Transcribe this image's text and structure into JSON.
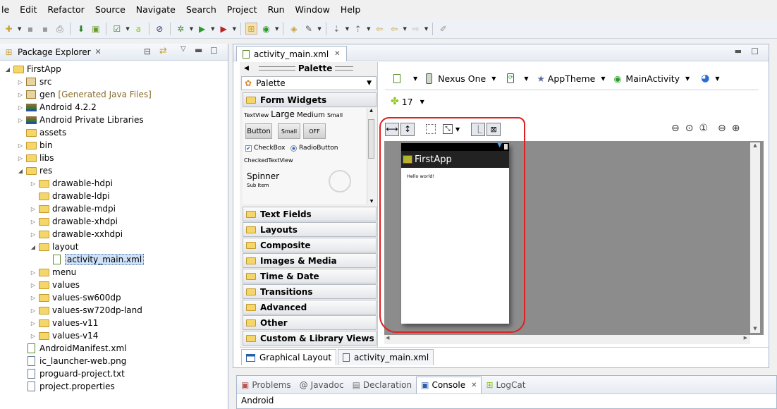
{
  "menu": [
    "le",
    "Edit",
    "Refactor",
    "Source",
    "Navigate",
    "Search",
    "Project",
    "Run",
    "Window",
    "Help"
  ],
  "package_explorer": {
    "title": "Package Explorer",
    "items": [
      {
        "label": "FirstApp",
        "suffix": "",
        "icon": "project-icon"
      },
      {
        "label": "src",
        "suffix": "",
        "icon": "package-folder-icon"
      },
      {
        "label": "gen",
        "suffix": " [Generated Java Files]",
        "icon": "package-folder-icon"
      },
      {
        "label": "Android 4.2.2",
        "suffix": "",
        "icon": "library-icon"
      },
      {
        "label": "Android Private Libraries",
        "suffix": "",
        "icon": "library-icon"
      },
      {
        "label": "assets",
        "suffix": "",
        "icon": "folder-icon"
      },
      {
        "label": "bin",
        "suffix": "",
        "icon": "folder-icon"
      },
      {
        "label": "libs",
        "suffix": "",
        "icon": "folder-icon"
      },
      {
        "label": "res",
        "suffix": "",
        "icon": "folder-icon"
      },
      {
        "label": "drawable-hdpi",
        "suffix": "",
        "icon": "folder-icon"
      },
      {
        "label": "drawable-ldpi",
        "suffix": "",
        "icon": "folder-icon"
      },
      {
        "label": "drawable-mdpi",
        "suffix": "",
        "icon": "folder-icon"
      },
      {
        "label": "drawable-xhdpi",
        "suffix": "",
        "icon": "folder-icon"
      },
      {
        "label": "drawable-xxhdpi",
        "suffix": "",
        "icon": "folder-icon"
      },
      {
        "label": "layout",
        "suffix": "",
        "icon": "folder-icon"
      },
      {
        "label": "activity_main.xml",
        "suffix": "",
        "icon": "xml-file-icon"
      },
      {
        "label": "menu",
        "suffix": "",
        "icon": "folder-icon"
      },
      {
        "label": "values",
        "suffix": "",
        "icon": "folder-icon"
      },
      {
        "label": "values-sw600dp",
        "suffix": "",
        "icon": "folder-icon"
      },
      {
        "label": "values-sw720dp-land",
        "suffix": "",
        "icon": "folder-icon"
      },
      {
        "label": "values-v11",
        "suffix": "",
        "icon": "folder-icon"
      },
      {
        "label": "values-v14",
        "suffix": "",
        "icon": "folder-icon"
      },
      {
        "label": "AndroidManifest.xml",
        "suffix": "",
        "icon": "xml-file-icon"
      },
      {
        "label": "ic_launcher-web.png",
        "suffix": "",
        "icon": "image-file-icon"
      },
      {
        "label": "proguard-project.txt",
        "suffix": "",
        "icon": "text-file-icon"
      },
      {
        "label": "project.properties",
        "suffix": "",
        "icon": "text-file-icon"
      }
    ]
  },
  "editor": {
    "tab_label": "activity_main.xml",
    "palette_title": "Palette",
    "palette_header": "Palette",
    "form_widgets_label": "Form Widgets",
    "widgets": {
      "textview": "TextView",
      "large": "Large",
      "medium": "Medium",
      "small": "Small",
      "button": "Button",
      "small_button": "Small",
      "toggle": "OFF",
      "checkbox": "CheckBox",
      "radio": "RadioButton",
      "checked_text": "CheckedTextView",
      "spinner": "Spinner",
      "sub_item": "Sub Item"
    },
    "categories": [
      "Text Fields",
      "Layouts",
      "Composite",
      "Images & Media",
      "Time & Date",
      "Transitions",
      "Advanced",
      "Other",
      "Custom & Library Views"
    ],
    "device": "Nexus One",
    "theme": "AppTheme",
    "activity": "MainActivity",
    "api_level": "17",
    "app_title": "FirstApp",
    "hello": "Hello world!",
    "bottom_tabs": [
      "Graphical Layout",
      "activity_main.xml"
    ]
  },
  "console": {
    "tabs": [
      "Problems",
      "Javadoc",
      "Declaration",
      "Console",
      "LogCat"
    ],
    "active": "Console",
    "content": "Android"
  },
  "colors": {
    "accent": "#e02020",
    "android_green": "#8fc31f",
    "selection": "#cfe2f7"
  }
}
